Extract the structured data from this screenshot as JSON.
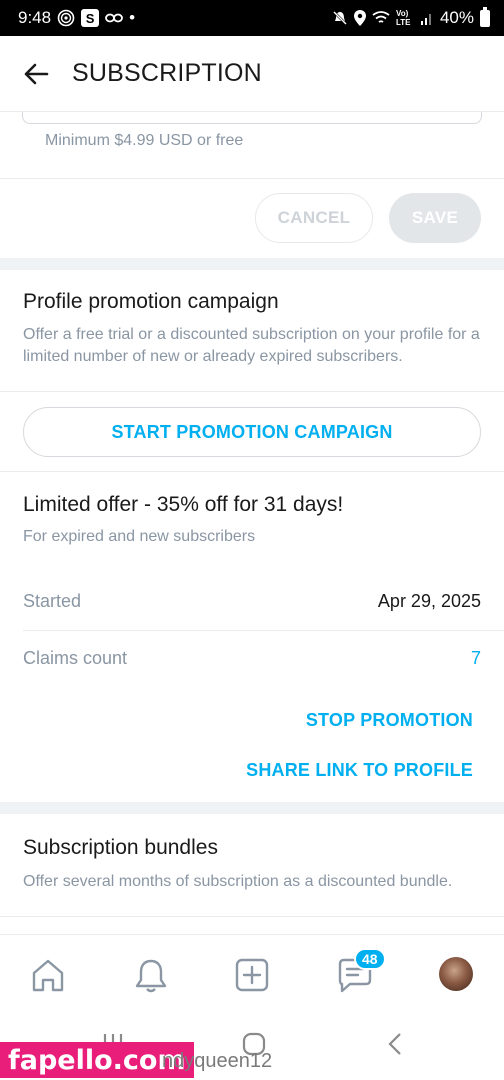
{
  "status_bar": {
    "time": "9:48",
    "s_badge": "S",
    "dot": "•",
    "net_label": "Vo) LTE",
    "battery": "40%"
  },
  "header": {
    "title": "SUBSCRIPTION"
  },
  "price_section": {
    "hint": "Minimum $4.99 USD or free",
    "cancel_label": "CANCEL",
    "save_label": "SAVE"
  },
  "promotion": {
    "title": "Profile promotion campaign",
    "description": "Offer a free trial or a discounted subscription on your profile for a limited number of new or already expired subscribers.",
    "start_label": "START PROMOTION CAMPAIGN"
  },
  "offer": {
    "title": "Limited offer - 35% off for 31 days!",
    "subtitle": "For expired and new subscribers",
    "rows": [
      {
        "label": "Started",
        "value": "Apr 29, 2025"
      },
      {
        "label": "Claims count",
        "value": "7"
      }
    ],
    "stop_label": "STOP PROMOTION",
    "share_label": "SHARE LINK TO PROFILE"
  },
  "bundles": {
    "title": "Subscription bundles",
    "description": "Offer several months of subscription as a discounted bundle."
  },
  "bottom_nav": {
    "items": [
      "home-icon",
      "bell-icon",
      "plus-square-icon",
      "messages-icon",
      "avatar"
    ],
    "messages_badge": "48"
  },
  "colors": {
    "accent": "#00aff0",
    "muted_text": "#8a96a3",
    "divider": "#e9ecef"
  },
  "watermark": {
    "brand": "fapello.com",
    "user": "ndyqueen12"
  }
}
